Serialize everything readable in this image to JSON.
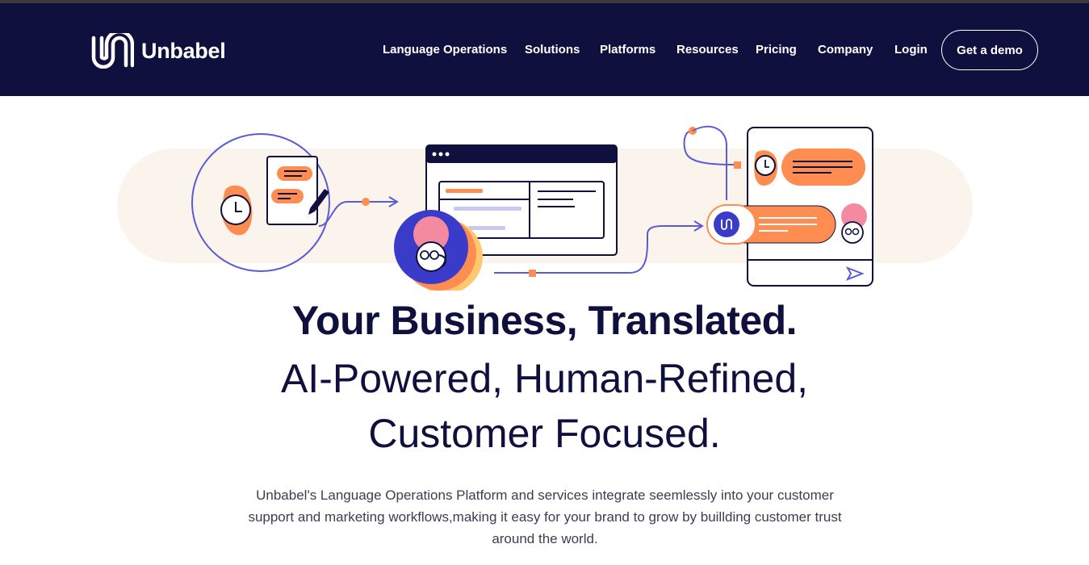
{
  "brand": {
    "name": "Unbabel"
  },
  "nav": {
    "items": [
      {
        "label": "Language Operations"
      },
      {
        "label": "Solutions"
      },
      {
        "label": "Platforms"
      },
      {
        "label": "Resources"
      },
      {
        "label": "Pricing"
      },
      {
        "label": "Company"
      },
      {
        "label": "Login"
      }
    ],
    "cta_label": "Get a demo"
  },
  "hero": {
    "title": "Your Business, Translated.",
    "subtitle_line1": "AI-Powered, Human-Refined,",
    "subtitle_line2": "Customer Focused.",
    "description": "Unbabel's Language Operations Platform and services integrate seemlessly into your customer support and marketing workflows,making it easy for your brand to grow by buillding customer trust around the world."
  },
  "colors": {
    "navy": "#10103f",
    "orange": "#ff8c50",
    "cream": "#faf4ec",
    "blue": "#3b3bc9",
    "pink": "#f48aa0"
  },
  "icons": [
    "unbabel-logo-icon",
    "clock-icon",
    "pen-icon",
    "arrow-right-icon",
    "send-icon"
  ]
}
